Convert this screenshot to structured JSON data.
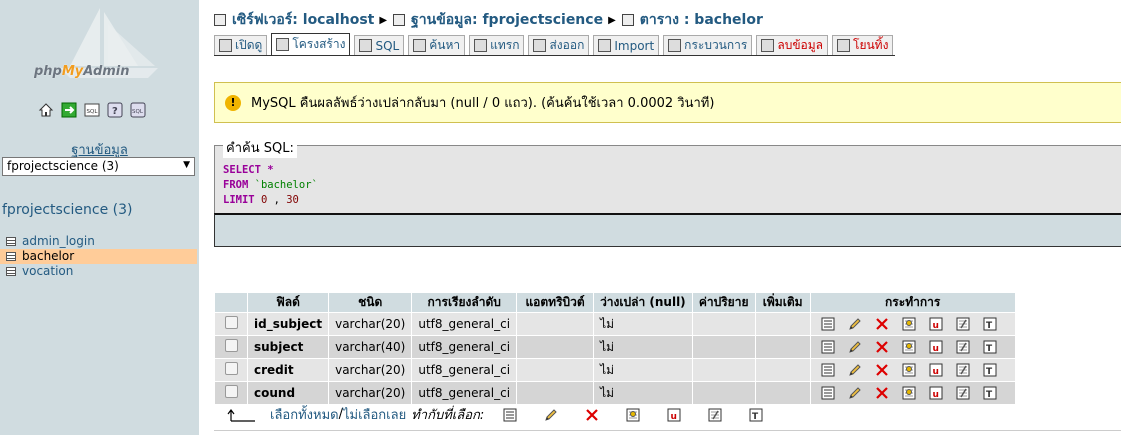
{
  "nav": {
    "logo_text_php": "php",
    "logo_text_my": "My",
    "logo_text_admin": "Admin",
    "db_label": "ฐานข้อมูล",
    "db_select_value": "fprojectscience (3)",
    "db_title": "fprojectscience (3)",
    "tables": [
      {
        "name": "admin_login"
      },
      {
        "name": "bachelor"
      },
      {
        "name": "vocation"
      }
    ]
  },
  "breadcrumb": {
    "server": "เซิร์ฟเวอร์: localhost",
    "database": "ฐานข้อมูล: fprojectscience",
    "table": "ตาราง : bachelor"
  },
  "tabs": [
    {
      "label": "เปิดดู"
    },
    {
      "label": "โครงสร้าง"
    },
    {
      "label": "SQL"
    },
    {
      "label": "ค้นหา"
    },
    {
      "label": "แทรก"
    },
    {
      "label": "ส่งออก"
    },
    {
      "label": "Import"
    },
    {
      "label": "กระบวนการ"
    },
    {
      "label": "ลบข้อมูล"
    },
    {
      "label": "โยนทิ้ง"
    }
  ],
  "notice": {
    "text": "MySQL คืนผลลัพธ์ว่างเปล่ากลับมา (null / 0 แถว). (ค้นค้นใช้เวลา 0.0002 วินาที)"
  },
  "sql": {
    "legend": "คำค้น SQL:",
    "select": "SELECT",
    "star": "*",
    "from": "FROM",
    "table": "`bachelor`",
    "limit": "LIMIT",
    "offset": "0",
    "comma": " , ",
    "count": "30"
  },
  "structure": {
    "headers": [
      "ฟิลด์",
      "ชนิด",
      "การเรียงลำดับ",
      "แอตทริบิวต์",
      "ว่างเปล่า (null)",
      "ค่าปริยาย",
      "เพิ่มเติม",
      "กระทำการ"
    ],
    "rows": [
      {
        "field": "id_subject",
        "type": "varchar(20)",
        "collation": "utf8_general_ci",
        "attributes": "",
        "null": "ไม่",
        "default": "",
        "extra": ""
      },
      {
        "field": "subject",
        "type": "varchar(40)",
        "collation": "utf8_general_ci",
        "attributes": "",
        "null": "ไม่",
        "default": "",
        "extra": ""
      },
      {
        "field": "credit",
        "type": "varchar(20)",
        "collation": "utf8_general_ci",
        "attributes": "",
        "null": "ไม่",
        "default": "",
        "extra": ""
      },
      {
        "field": "cound",
        "type": "varchar(20)",
        "collation": "utf8_general_ci",
        "attributes": "",
        "null": "ไม่",
        "default": "",
        "extra": ""
      }
    ]
  },
  "footer": {
    "check_all": "เลือกทั้งหมด",
    "sep": " / ",
    "uncheck_all": "ไม่เลือกเลย",
    "with_selected": "ทำกับที่เลือก:"
  },
  "colors": {
    "nav_bg": "#d0dce0",
    "link": "#235a81",
    "notice_bg": "#ffffcc",
    "active_row": "#ffcc99"
  }
}
